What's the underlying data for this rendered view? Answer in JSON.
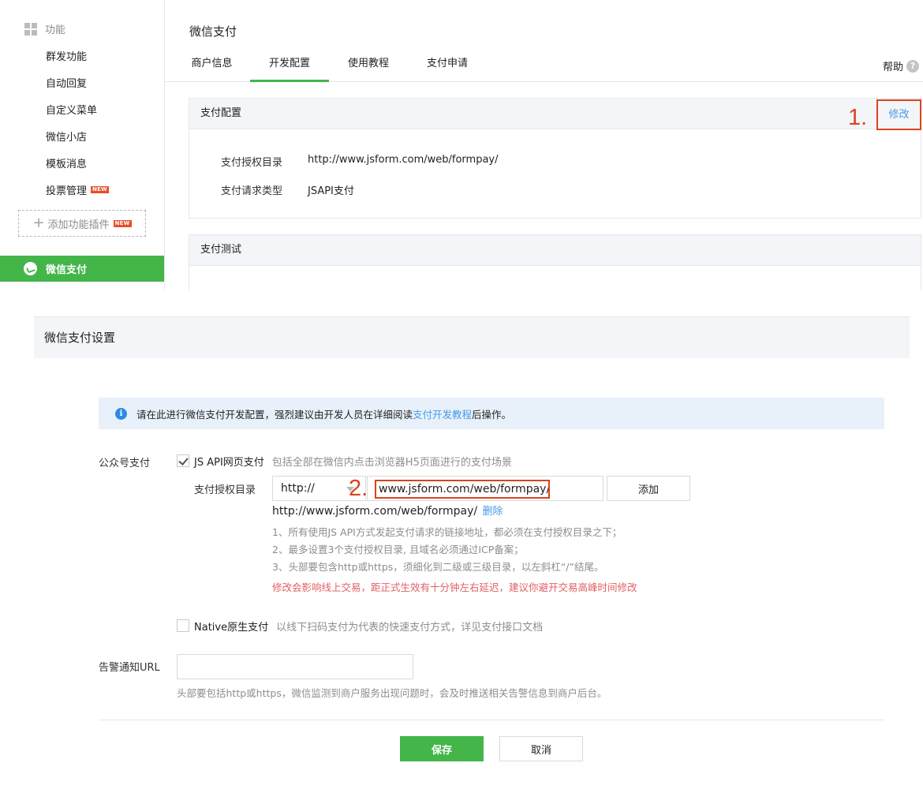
{
  "sidebar": {
    "section_title": "功能",
    "items": [
      {
        "label": "群发功能"
      },
      {
        "label": "自动回复"
      },
      {
        "label": "自定义菜单"
      },
      {
        "label": "微信小店"
      },
      {
        "label": "模板消息"
      },
      {
        "label": "投票管理",
        "badge": "NEW"
      }
    ],
    "add_plugin": {
      "label": "添加功能插件",
      "badge": "NEW"
    },
    "active_item": "微信支付"
  },
  "header": {
    "title": "微信支付",
    "tabs": [
      {
        "label": "商户信息",
        "active": false
      },
      {
        "label": "开发配置",
        "active": true
      },
      {
        "label": "使用教程",
        "active": false
      },
      {
        "label": "支付申请",
        "active": false
      }
    ],
    "help_label": "帮助"
  },
  "pay_config": {
    "title": "支付配置",
    "edit_label": "修改",
    "step_marker": "1.",
    "rows": [
      {
        "key": "支付授权目录",
        "value": "http://www.jsform.com/web/formpay/"
      },
      {
        "key": "支付请求类型",
        "value": "JSAPI支付"
      }
    ]
  },
  "pay_test": {
    "title": "支付测试"
  },
  "settings": {
    "title": "微信支付设置",
    "notice": {
      "prefix": "请在此进行微信支付开发配置，强烈建议由开发人员在详细阅读",
      "link": "支付开发教程",
      "suffix": "后操作。"
    },
    "public_pay": {
      "label": "公众号支付",
      "jsapi_option": {
        "label": "JS API网页支付",
        "desc": "包括全部在微信内点击浏览器H5页面进行的支付场景",
        "checked": true
      },
      "dir_label": "支付授权目录",
      "protocol": "http://",
      "url_value": "www.jsform.com/web/formpay/",
      "step_marker": "2.",
      "add_button": "添加",
      "saved_url": "http://www.jsform.com/web/formpay/",
      "delete_link": "删除",
      "hints": [
        "1、所有使用JS API方式发起支付请求的链接地址，都必须在支付授权目录之下；",
        "2、最多设置3个支付授权目录, 且域名必须通过ICP备案；",
        "3、头部要包含http或https，须细化到二级或三级目录，以左斜杠“/”结尾。"
      ],
      "warning": "修改会影响线上交易，距正式生效有十分钟左右延迟，建议你避开交易高峰时间修改",
      "native_option": {
        "label": "Native原生支付",
        "desc": "以线下扫码支付为代表的快速支付方式，详见支付接口文档",
        "checked": false
      }
    },
    "alert": {
      "label": "告警通知URL",
      "value": "",
      "hint": "头部要包括http或https，微信监测到商户服务出现问题时，会及时推送相关告警信息到商户后台。"
    },
    "buttons": {
      "save": "保存",
      "cancel": "取消"
    }
  },
  "colors": {
    "brand_green": "#44b549",
    "link_blue": "#459ae9",
    "annotation_red": "#d9441d",
    "warning_red": "#e15f63"
  }
}
